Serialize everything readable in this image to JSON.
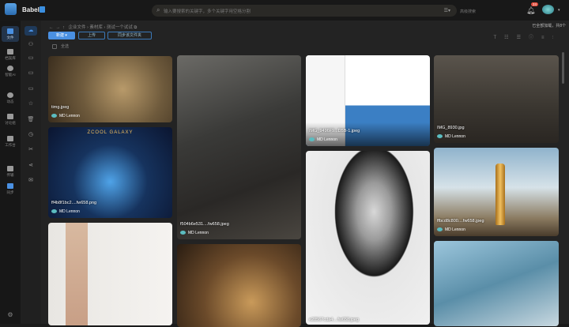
{
  "header": {
    "app_name": "Babel",
    "search_placeholder": "输入要搜索的关键字，多个关键字用空格分割",
    "advanced_search": "高级搜索",
    "notification_count": "24"
  },
  "rail": [
    {
      "label": "文件",
      "active": true
    },
    {
      "label": "档案库"
    },
    {
      "label": "智能AI"
    },
    {
      "label": "动态"
    },
    {
      "label": "讨论组"
    },
    {
      "label": "工作台"
    },
    {
      "label": "传输"
    },
    {
      "label": "同步"
    }
  ],
  "breadcrumb": [
    "企业文件",
    "素材库",
    "测试一个试试"
  ],
  "toolbar": {
    "new": "新建 ▾",
    "upload": "上传",
    "sync": "同步该文件夹",
    "select_all": "全选",
    "loaded": "已全部加载，共8个"
  },
  "cards": [
    {
      "name": "timg.jpeg",
      "owner": "MD Lennon"
    },
    {
      "name": "ff4b8f1bc2....fw658.png",
      "owner": "MD Lennon",
      "title": "ZCOOL GALAXY"
    },
    {
      "name": "f504b6e531....fw658.jpeg",
      "owner": "MD Lennon"
    },
    {
      "name": "IMG_9496F9...D5B-1.jpeg",
      "owner": "MD Lennon"
    },
    {
      "name": "e28567cda4....fw658.jpeg"
    },
    {
      "name": "IMG_8930.jpg",
      "owner": "MD Lennon"
    },
    {
      "name": "ffbcd8c800....fw658.jpeg",
      "owner": "MD Lennon"
    }
  ]
}
